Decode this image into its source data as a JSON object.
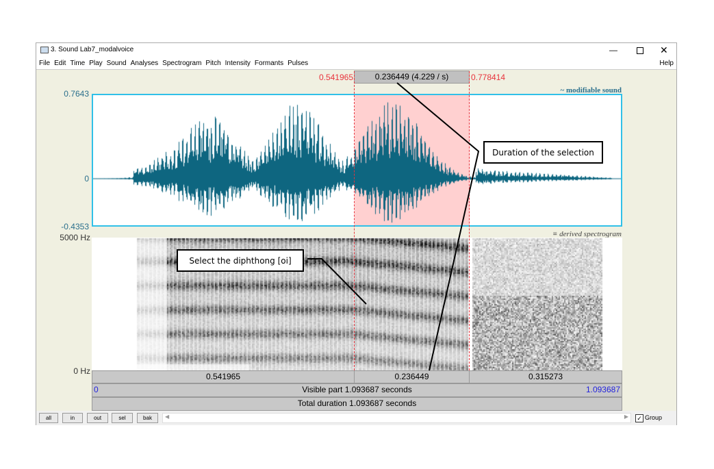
{
  "window": {
    "title": "3. Sound Lab7_modalvoice",
    "controls": [
      "minimize",
      "maximize",
      "close"
    ]
  },
  "menu": [
    "File",
    "Edit",
    "Time",
    "Play",
    "Sound",
    "Analyses",
    "Spectrogram",
    "Pitch",
    "Intensity",
    "Formants",
    "Pulses"
  ],
  "help": "Help",
  "selection": {
    "start": "0.541965",
    "end": "0.778414",
    "duration": "0.236449 (4.229 / s)"
  },
  "waveform": {
    "max": "0.7643",
    "zero": "0",
    "min": "-0.4353",
    "label": "~ modifiable sound",
    "color": "#0e6680"
  },
  "spectrogram": {
    "top": "5000 Hz",
    "bottom": "0 Hz",
    "label": "derived spectrogram"
  },
  "segments": [
    "0.541965",
    "0.236449",
    "0.315273"
  ],
  "visible": {
    "start": "0",
    "text": "Visible part 1.093687 seconds",
    "end": "1.093687"
  },
  "total": "Total duration 1.093687 seconds",
  "buttons": [
    "all",
    "in",
    "out",
    "sel",
    "bak"
  ],
  "group": {
    "label": "Group",
    "checked": true
  },
  "annotations": {
    "duration": "Duration of the selection",
    "diphthong": "Select the diphthong [oi]"
  }
}
